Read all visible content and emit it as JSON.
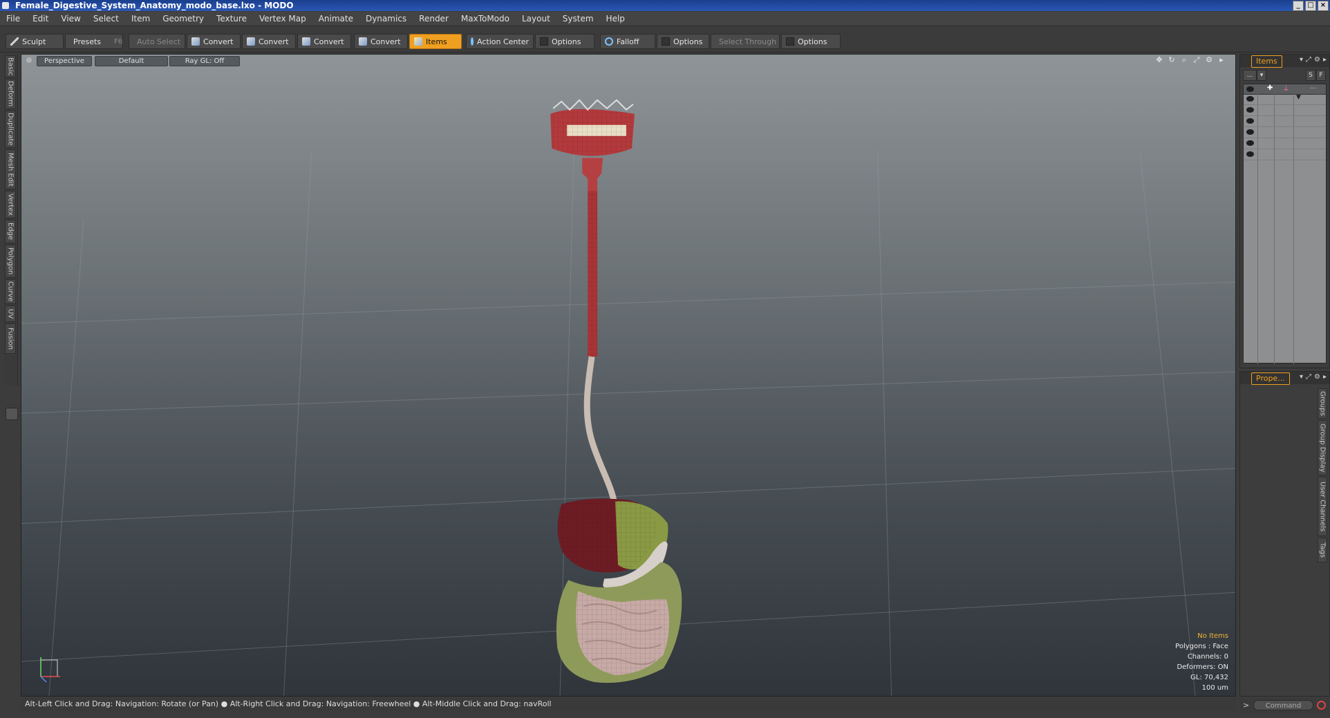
{
  "window": {
    "title": "Female_Digestive_System_Anatomy_modo_base.lxo - MODO",
    "buttons": [
      "_",
      "□",
      "×"
    ]
  },
  "menu": [
    "File",
    "Edit",
    "View",
    "Select",
    "Item",
    "Geometry",
    "Texture",
    "Vertex Map",
    "Animate",
    "Dynamics",
    "Render",
    "MaxToModo",
    "Layout",
    "System",
    "Help"
  ],
  "toolbar": {
    "sculpt": "Sculpt",
    "presets": "Presets",
    "presets_key": "F6",
    "auto_select": "Auto Select",
    "convert1": "Convert",
    "convert2": "Convert",
    "convert3": "Convert",
    "convert4": "Convert",
    "items": "Items",
    "action_center": "Action Center",
    "options1": "Options",
    "falloff": "Falloff",
    "options2": "Options",
    "select_through": "Select Through",
    "options3": "Options"
  },
  "left_tabs": [
    "Basic",
    "Deform",
    "Duplicate",
    "Mesh Edit",
    "Vertex",
    "Edge",
    "Polygon",
    "Curve",
    "UV",
    "Fusion"
  ],
  "viewport": {
    "view": "Perspective",
    "style": "Default",
    "raygl": "Ray GL: Off",
    "info": {
      "items": "No Items",
      "polygons": "Polygons : Face",
      "channels": "Channels: 0",
      "deformers": "Deformers: ON",
      "gl": "GL: 70,432",
      "scale": "100 um"
    },
    "colors": {
      "selection_accent": "#f5b434"
    }
  },
  "status": "Alt-Left Click and Drag: Navigation: Rotate (or Pan) ● Alt-Right Click and Drag: Navigation: Freewheel ● Alt-Middle Click and Drag: navRoll",
  "items_panel": {
    "tab": "Items",
    "dots": "...",
    "s": "S",
    "f": "F",
    "rows": 6
  },
  "props_panel": {
    "tab": "Prope...",
    "side_tabs": [
      "Groups",
      "Group Display",
      "User Channels",
      "Tags"
    ]
  },
  "command": {
    "placeholder": "Command",
    "prompt": ">"
  },
  "accent_color": "#f0a020"
}
